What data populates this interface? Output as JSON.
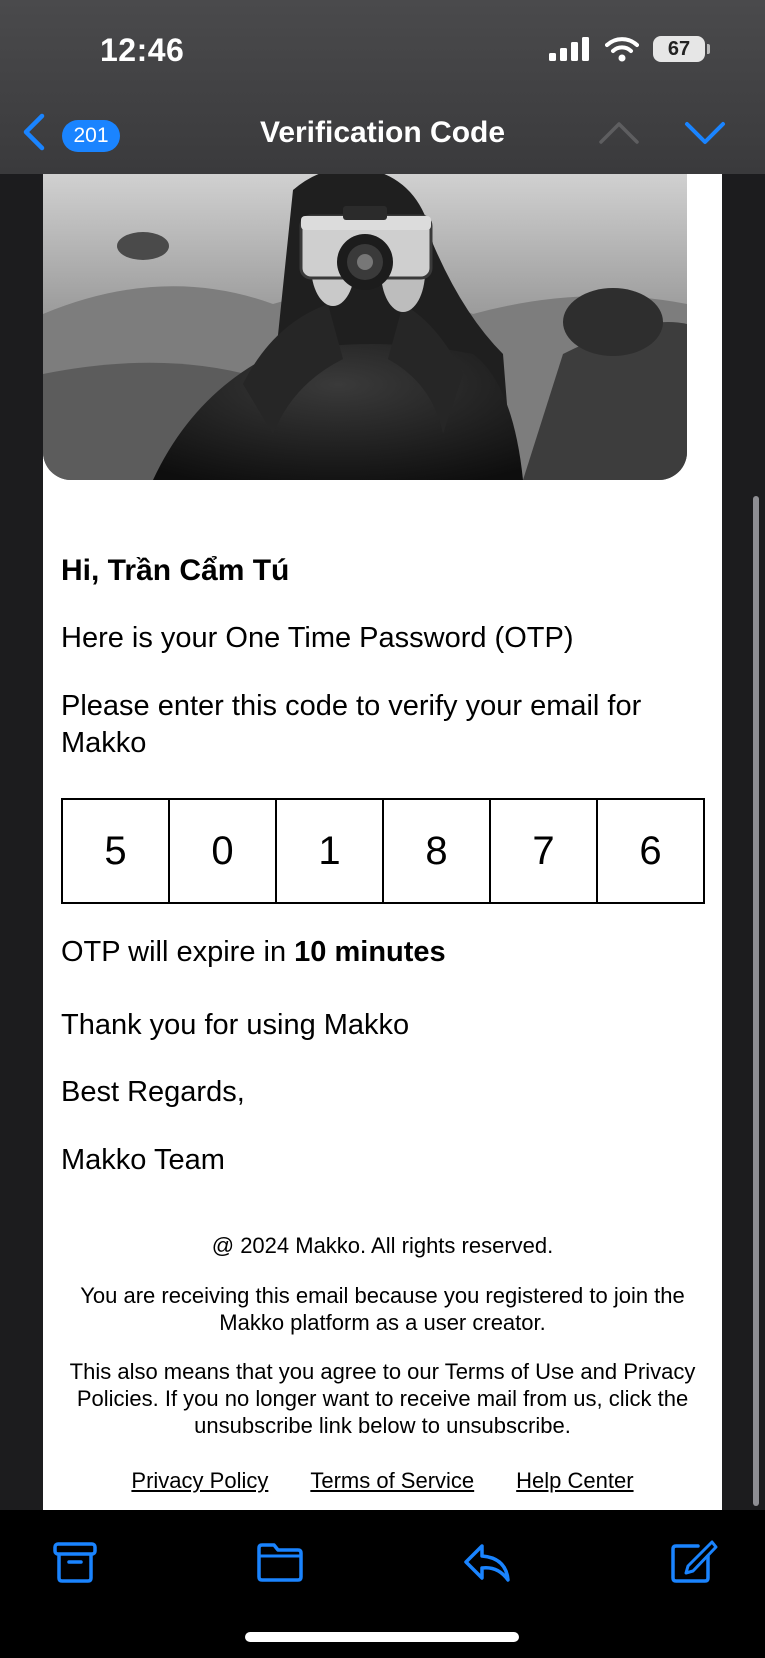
{
  "status_bar": {
    "time": "12:46",
    "battery": "67"
  },
  "nav": {
    "unread_count": "201",
    "title": "Verification Code"
  },
  "email": {
    "greeting": "Hi, Trần Cẩm Tú",
    "intro": "Here is your One Time Password (OTP)",
    "instruction": "Please enter this code to verify your email for Makko",
    "otp_digits": [
      "5",
      "0",
      "1",
      "8",
      "7",
      "6"
    ],
    "expire_prefix": "OTP will expire in ",
    "expire_duration": "10 minutes",
    "thanks": "Thank you for using Makko",
    "regards": "Best Regards,",
    "signature": "Makko Team",
    "footer": {
      "copyright": "@ 2024 Makko. All rights reserved.",
      "reason": "You are receiving this email because you registered to join the Makko platform as a user creator.",
      "terms_note": "This also means that you agree to our Terms of Use and Privacy Policies. If you no longer want to receive mail from us, click the unsubscribe link below to unsubscribe.",
      "links": [
        "Privacy Policy",
        "Terms of Service",
        "Help Center"
      ]
    }
  },
  "toolbar": {
    "icons": [
      "archive-icon",
      "folder-icon",
      "reply-icon",
      "compose-icon"
    ],
    "accent": "#1a84ff"
  }
}
